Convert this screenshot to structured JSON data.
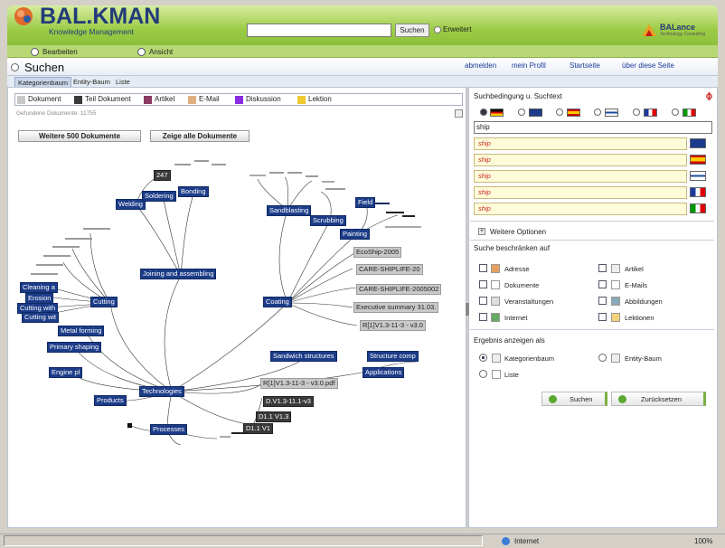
{
  "app": {
    "logo": "BAL.KMAN",
    "logo_sub": "Knowledge Management",
    "brand": "BALance",
    "brand_sub": "Technology Consulting"
  },
  "search": {
    "button": "Suchen",
    "advanced": "Erweitert",
    "value": ""
  },
  "modes": [
    "Bearbeiten",
    "Ansicht"
  ],
  "page": {
    "title": "Suchen",
    "links": [
      "abmelden",
      "mein Profil",
      "Startseite",
      "über diese Seite"
    ]
  },
  "tabs": [
    "Kategorienbaum",
    "Entity-Baum",
    "Liste"
  ],
  "legend": [
    {
      "label": "Dokument",
      "color": "#c8c8c8"
    },
    {
      "label": "Teil Dokument",
      "color": "#3a3a3a"
    },
    {
      "label": "Artikel",
      "color": "#8b3a62"
    },
    {
      "label": "E-Mail",
      "color": "#e0b080"
    },
    {
      "label": "Diskussion",
      "color": "#8a2be2"
    },
    {
      "label": "Lektion",
      "color": "#f0c830"
    }
  ],
  "found_text": "Gefundene Dokumente: 11755",
  "buttons": {
    "more": "Weitere 500 Dokumente",
    "all": "Zeige alle Dokumente"
  },
  "tree": {
    "labels": {
      "joining": "Joining and assembling",
      "coating": "Coating",
      "technologies": "Technologies",
      "cutting": "Cutting",
      "metal_forming": "Metal forming",
      "primary_shaping": "Primary shaping",
      "engine": "Engine pl",
      "products": "Products",
      "processes": "Processes",
      "sandwich": "Sandwich structures",
      "structure": "Structure comp",
      "applications": "Applications",
      "sandblasting": "Sandblasting",
      "scrubbing": "Scrubbing",
      "painting": "Painting",
      "field": "Field",
      "ecoship": "EcoShip-2005",
      "care1": "CARE-SHIPLIFE-20",
      "care2": "CARE-SHIPLIFE-2005002",
      "exec": "Executive summary 31.03.",
      "r1": "R[1]V1.3-11-3 - v3.0",
      "r2": "R[1]V1.3-11-3 - v3.0.pdf",
      "welding": "Welding",
      "soldering": "Soldering",
      "bonding": "Bonding",
      "n247": "247",
      "cleaning": "Cleaning a",
      "erosion": "Erosion",
      "cutting_water": "Cutting with",
      "cutting_wit": "Cutting wit",
      "d1": "D.V1.3-11.1-v3",
      "d2": "D1.1 V1.3",
      "d3": "D1.1 V1"
    }
  },
  "right": {
    "title": "Suchbedingung u. Suchtext",
    "query": "ship",
    "translations": [
      "ship",
      "ship",
      "ship",
      "ship",
      "ship"
    ],
    "more_options": "Weitere Optionen",
    "restrict_title": "Suche beschränken auf",
    "filters_left": [
      "Adresse",
      "Dokumente",
      "Veranstaltungen",
      "Internet"
    ],
    "filters_right": [
      "Artikel",
      "E-Mails",
      "Abbildungen",
      "Lektionen"
    ],
    "display_title": "Ergebnis anzeigen als",
    "display_options": [
      "Kategorienbaum",
      "Entity-Baum",
      "Liste"
    ],
    "search_btn": "Suchen",
    "reset_btn": "Zurücksetzen"
  },
  "status": {
    "zone": "Internet",
    "zoom": "100%"
  }
}
